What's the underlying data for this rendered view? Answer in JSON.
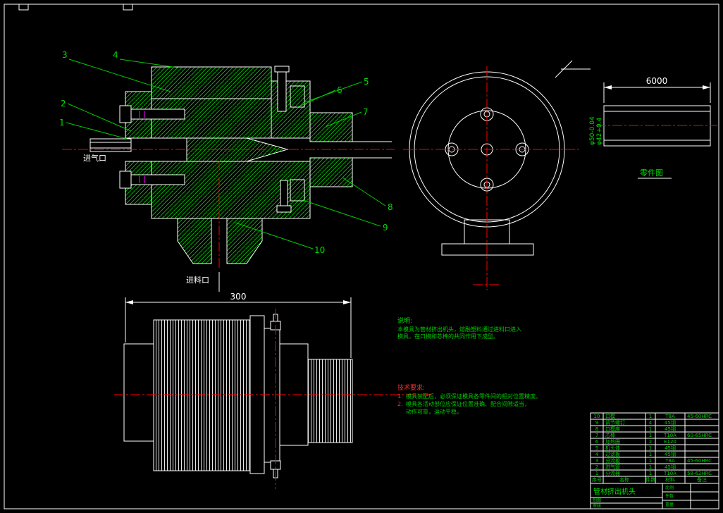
{
  "window": {
    "background": "#000000"
  },
  "colors": {
    "line": "#ffffff",
    "hatch_green": "#00b400",
    "centerline_red": "#ff0000",
    "detail_magenta": "#ff00ff",
    "callout_green": "#00dd00",
    "note_green": "#00c800",
    "note_red": "#ff3030"
  },
  "section_view": {
    "air_inlet_label": "进气口",
    "feed_inlet_label": "进料口",
    "callouts": [
      "1",
      "2",
      "3",
      "4",
      "5",
      "6",
      "7",
      "8",
      "9",
      "10"
    ]
  },
  "part_view": {
    "dim_length": "6000",
    "dia_outer": "φ50-0.04",
    "dia_inner": "φ42+0.4",
    "caption": "零件图"
  },
  "side_view": {
    "dim_width": "300"
  },
  "notes": {
    "desc_title": "说明:",
    "desc_lines": [
      "本模具为管材挤出机头，熔融塑料通过进料口进入",
      "模具，在口模和芯棒的共同作用下成型。"
    ],
    "tech_title": "技术要求:",
    "tech_lines": [
      {
        "num": "1.",
        "text": "模具装配后，必须保证模具各零件间的相对位置精度。"
      },
      {
        "num": "2.",
        "text": "模具各活动部位应保证位置准确、配合间隙适当，"
      },
      {
        "num": "",
        "text": "动作可靠，运动平稳。"
      }
    ]
  },
  "title_block": {
    "headers": {
      "no": "序号",
      "name": "名称",
      "qty": "件数",
      "material": "材料",
      "note": "备注"
    },
    "parts": [
      {
        "no": "10",
        "name": "口模",
        "qty": "1",
        "material": "T8A",
        "note": "45-60HRC"
      },
      {
        "no": "9",
        "name": "调节螺钉",
        "qty": "4",
        "material": "45钢",
        "note": ""
      },
      {
        "no": "8",
        "name": "口模座",
        "qty": "1",
        "material": "45钢",
        "note": ""
      },
      {
        "no": "7",
        "name": "芯棒",
        "qty": "1",
        "material": "T10A",
        "note": "60-65HRC"
      },
      {
        "no": "6",
        "name": "加热圈",
        "qty": "2",
        "material": "E120",
        "note": ""
      },
      {
        "no": "5",
        "name": "机头体",
        "qty": "1",
        "material": "45钢",
        "note": ""
      },
      {
        "no": "4",
        "name": "过滤板",
        "qty": "1",
        "material": "45钢",
        "note": ""
      },
      {
        "no": "3",
        "name": "分流梭",
        "qty": "1",
        "material": "T8A",
        "note": "45-60HRC"
      },
      {
        "no": "2",
        "name": "进气管",
        "qty": "1",
        "material": "45钢",
        "note": ""
      },
      {
        "no": "1",
        "name": "分流器",
        "qty": "1",
        "material": "T10A",
        "note": "58-62HRC"
      }
    ],
    "title": "管材挤出机头",
    "drawn_label": "制图",
    "checked_label": "审核",
    "scale_label": "比例",
    "qty_label": "件数",
    "weight_label": "重量"
  }
}
